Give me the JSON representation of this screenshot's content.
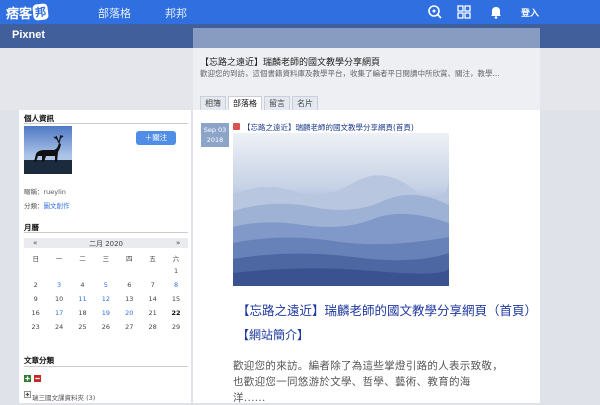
{
  "topbar": {
    "logo_text": "痞客",
    "logo_badge": "邦",
    "nav": [
      "部落格",
      "邦邦"
    ],
    "login_label": "登入"
  },
  "blog": {
    "name": "Pixnet",
    "title": "【忘路之遠近】瑞麟老師的國文教學分享網頁",
    "description": "歡迎您的到訪，這個書籍資料庫及教學平台，收集了編者平日閱讀中所欣賞、關注，教學..."
  },
  "tabs": [
    {
      "label": "相簿",
      "active": false
    },
    {
      "label": "部落格",
      "active": true
    },
    {
      "label": "留言",
      "active": false
    },
    {
      "label": "名片",
      "active": false
    }
  ],
  "sidebar": {
    "profile_heading": "個人資訊",
    "follow_label": "＋關注",
    "account_label": "暱稱：",
    "account_value": "rueylin",
    "category_label": "分類：",
    "category_value": "圖文創作",
    "calendar_heading": "月曆",
    "calendar": {
      "prev": "«",
      "next": "»",
      "month": "二月 2020",
      "weekdays": [
        "日",
        "一",
        "二",
        "三",
        "四",
        "五",
        "六"
      ],
      "weeks": [
        [
          "",
          "",
          "",
          "",
          "",
          "",
          "1"
        ],
        [
          "2",
          "3",
          "4",
          "5",
          "6",
          "7",
          "8"
        ],
        [
          "9",
          "10",
          "11",
          "12",
          "13",
          "14",
          "15"
        ],
        [
          "16",
          "17",
          "18",
          "19",
          "20",
          "21",
          "22"
        ],
        [
          "23",
          "24",
          "25",
          "26",
          "27",
          "28",
          "29"
        ]
      ],
      "linked_days": [
        "3",
        "5",
        "8",
        "11",
        "12",
        "17",
        "19",
        "20"
      ],
      "today": "22"
    },
    "categories_heading": "文章分類",
    "category_item": "瑞三國文課資料夾 (3)"
  },
  "post": {
    "date_month": "Sep 03",
    "date_year": "2018",
    "title": "【忘路之遠近】瑞麟老師的國文教學分享網頁(首頁)",
    "big_title": "【忘路之遠近】瑞麟老師的國文教學分享網頁（首頁）",
    "subtitle": "【網站簡介】",
    "paragraph_lines": [
      "歡迎您的來訪。編者除了為這些掌燈引路的人表示致敬，",
      "也歡迎您一同悠游於文學、哲學、藝術、教育的海",
      "洋......"
    ]
  },
  "colors": {
    "topbar": "#2f6fe0",
    "blogbar": "#405f9b",
    "link": "#2f6fe0",
    "post_title": "#1e3aa0"
  }
}
